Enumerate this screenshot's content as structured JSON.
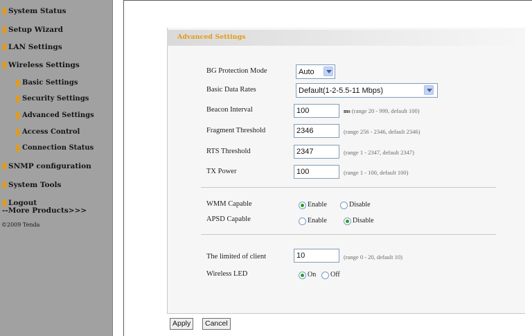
{
  "sidebar": {
    "items": [
      {
        "label": "System Status"
      },
      {
        "label": "Setup Wizard"
      },
      {
        "label": "LAN Settings"
      },
      {
        "label": "Wireless Settings"
      },
      {
        "label": "Basic Settings"
      },
      {
        "label": "Security Settings"
      },
      {
        "label": "Advanced Settings"
      },
      {
        "label": "Access Control"
      },
      {
        "label": "Connection Status"
      },
      {
        "label": "SNMP configuration"
      },
      {
        "label": "System Tools"
      },
      {
        "label": "Logout"
      }
    ],
    "more_products": "--More Products>>>",
    "copyright": "©2009 Tenda",
    "accent_color": "#e39b17",
    "background_color": "#a1a1a1"
  },
  "main": {
    "section_title": "Advanced Settings",
    "bg_protection": {
      "label": "BG Protection Mode",
      "value": "Auto"
    },
    "basic_rates": {
      "label": "Basic Data Rates",
      "value": "Default(1-2-5.5-11 Mbps)"
    },
    "beacon": {
      "label": "Beacon Interval",
      "value": "100",
      "unit": "ms",
      "hint": "(range 20 - 999, default 100)"
    },
    "fragment": {
      "label": "Fragment Threshold",
      "value": "2346",
      "hint": "(range 256 - 2346, default 2346)"
    },
    "rts": {
      "label": "RTS Threshold",
      "value": "2347",
      "hint": "(range 1 - 2347, default 2347)"
    },
    "tx_power": {
      "label": "TX Power",
      "value": "100",
      "hint": "(range 1 - 100, default 100)"
    },
    "wmm": {
      "label": "WMM Capable",
      "enable": "Enable",
      "disable": "Disable",
      "selected": "Enable"
    },
    "apsd": {
      "label": "APSD Capable",
      "enable": "Enable",
      "disable": "Disable",
      "selected": "Disable"
    },
    "client_limit": {
      "label": "The limited of client",
      "value": "10",
      "hint": "(range 0 - 20, default 10)"
    },
    "wireless_led": {
      "label": "Wireless LED",
      "on": "On",
      "off": "Off",
      "selected": "On"
    },
    "apply_label": "Apply",
    "cancel_label": "Cancel",
    "selected_radio_color": "#21a321"
  }
}
